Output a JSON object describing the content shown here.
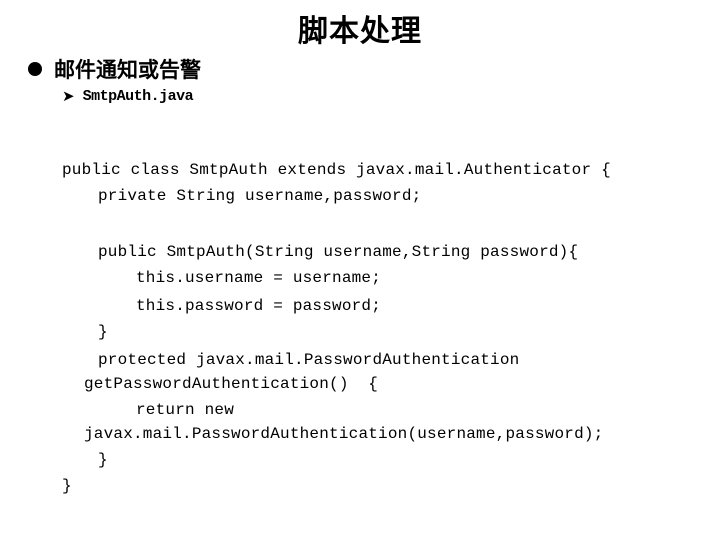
{
  "slide": {
    "title": "脚本处理",
    "bullet": "邮件通知或告警",
    "sub_bullet_icon": "arrow-right-icon",
    "sub_bullet": "SmtpAuth.java",
    "code_lines": [
      "public class SmtpAuth extends javax.mail.Authenticator {",
      "private String username,password;",
      "public SmtpAuth(String username,String password){",
      "this.username = username;",
      "this.password = password;",
      "}",
      "protected javax.mail.PasswordAuthentication",
      "getPasswordAuthentication()  {",
      "return new",
      "javax.mail.PasswordAuthentication(username,password);",
      "}",
      "}"
    ]
  }
}
